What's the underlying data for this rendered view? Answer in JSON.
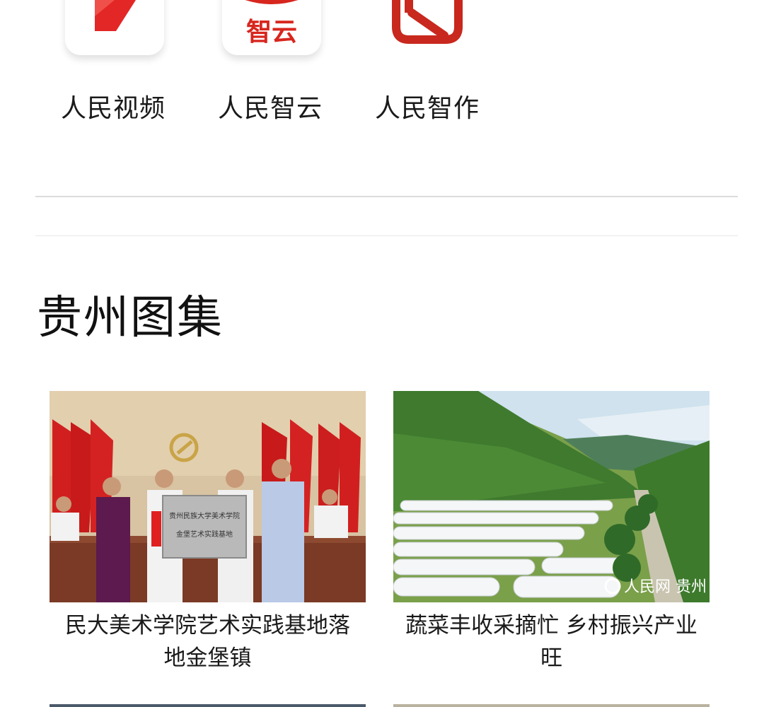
{
  "apps": [
    {
      "label": "人民视频",
      "icon": "renmin-video-app-icon"
    },
    {
      "label": "人民智云",
      "icon": "renmin-zhiyun-app-icon",
      "icon_text": "智云"
    },
    {
      "label": "人民智作",
      "icon": "renmin-zhizuo-app-icon"
    }
  ],
  "section": {
    "title": "贵州图集"
  },
  "gallery": [
    {
      "title": "民大美术学院艺术实践基地落地金堡镇",
      "plaque_text": [
        "贵州民族大学美术学院",
        "金堡艺术实践基地"
      ]
    },
    {
      "title": "蔬菜丰收采摘忙 乡村振兴产业旺",
      "watermark": "人民网 贵州"
    }
  ],
  "colors": {
    "brand_red": "#d7261e",
    "divider": "#dcdcdc"
  }
}
